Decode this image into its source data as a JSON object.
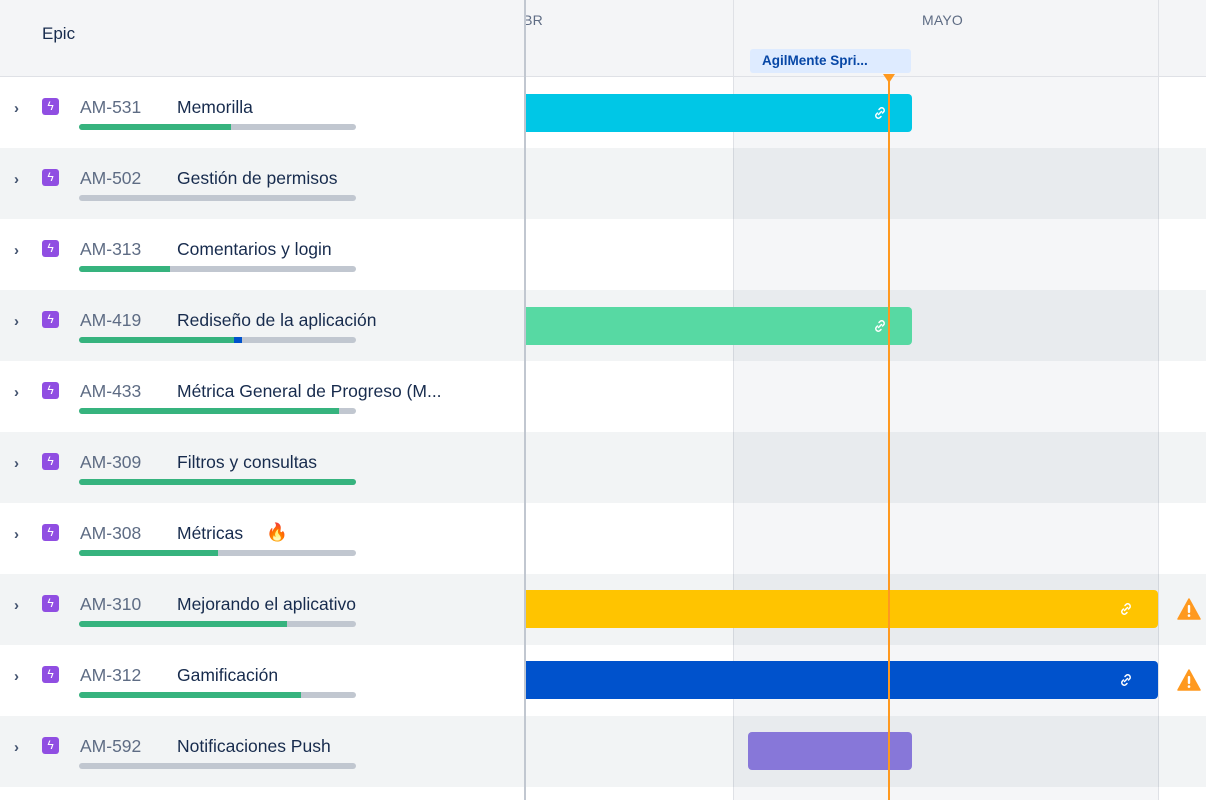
{
  "header": {
    "epic_label": "Epic",
    "months": [
      "ABR",
      "MAYO"
    ],
    "sprint_label": "AgilMente Spri..."
  },
  "colors": {
    "epic_icon": "#904ee2",
    "progress_done": "#36b37e",
    "progress_inprogress": "#0052cc",
    "progress_todo": "#c1c7d0",
    "today_line": "#ff991f",
    "warning": "#ff991f"
  },
  "icons": {
    "expand": "chevron-right-icon",
    "epic": "lightning-bolt-icon",
    "bar_link": "link-icon",
    "warning": "warning-triangle-icon",
    "emoji_fire": "🔥"
  },
  "epics": [
    {
      "key": "AM-531",
      "summary": "Memorilla",
      "progress_done": 0.55,
      "progress_in_progress": 0,
      "bar_color": "#00c7e6",
      "has_link": true,
      "warning": false
    },
    {
      "key": "AM-502",
      "summary": "Gestión de permisos",
      "progress_done": 0,
      "progress_in_progress": 0,
      "bar_color": null,
      "has_link": false,
      "warning": false
    },
    {
      "key": "AM-313",
      "summary": "Comentarios y login",
      "progress_done": 0.33,
      "progress_in_progress": 0,
      "bar_color": null,
      "has_link": false,
      "warning": false
    },
    {
      "key": "AM-419",
      "summary": "Rediseño de la aplicación",
      "progress_done": 0.56,
      "progress_in_progress": 0.03,
      "bar_color": "#57d9a3",
      "has_link": true,
      "warning": false
    },
    {
      "key": "AM-433",
      "summary": "Métrica General de Progreso (M...",
      "progress_done": 0.94,
      "progress_in_progress": 0,
      "bar_color": null,
      "has_link": false,
      "warning": false
    },
    {
      "key": "AM-309",
      "summary": "Filtros y consultas",
      "progress_done": 1.0,
      "progress_in_progress": 0,
      "bar_color": null,
      "has_link": false,
      "warning": false
    },
    {
      "key": "AM-308",
      "summary": "Métricas",
      "progress_done": 0.5,
      "progress_in_progress": 0,
      "bar_color": null,
      "has_link": false,
      "warning": false
    },
    {
      "key": "AM-310",
      "summary": "Mejorando el aplicativo",
      "progress_done": 0.75,
      "progress_in_progress": 0,
      "bar_color": "#ffc400",
      "has_link": true,
      "warning": true
    },
    {
      "key": "AM-312",
      "summary": "Gamificación",
      "progress_done": 0.8,
      "progress_in_progress": 0,
      "bar_color": "#0052cc",
      "has_link": true,
      "warning": true
    },
    {
      "key": "AM-592",
      "summary": "Notificaciones Push",
      "progress_done": 0,
      "progress_in_progress": 0,
      "bar_color": "#8777d9",
      "has_link": false,
      "warning": false
    }
  ]
}
